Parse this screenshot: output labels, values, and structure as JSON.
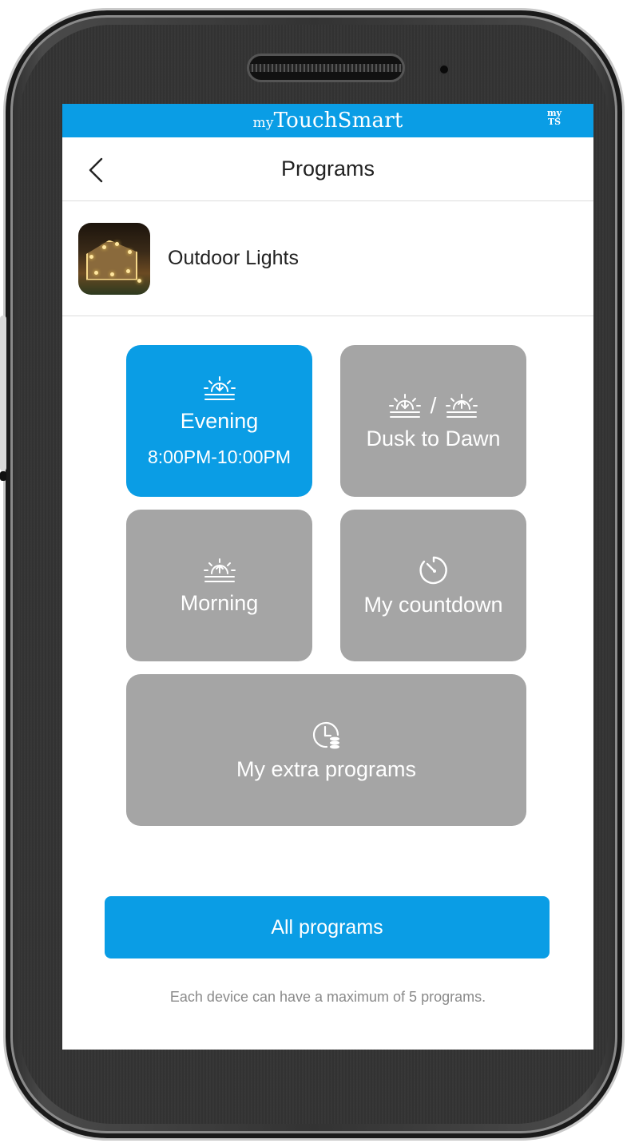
{
  "app": {
    "brand_prefix": "my",
    "brand_name": "TouchSmart",
    "brand_logo_line1": "my",
    "brand_logo_line2": "TS"
  },
  "nav": {
    "title": "Programs",
    "back_icon": "chevron-left-icon"
  },
  "device": {
    "name": "Outdoor Lights"
  },
  "programs": [
    {
      "label": "Evening",
      "time": "8:00PM-10:00PM",
      "icon": "sunset-icon",
      "active": true
    },
    {
      "label": "Dusk to Dawn",
      "separator": "/",
      "icon": "sunset-sunrise-icon",
      "active": false
    },
    {
      "label": "Morning",
      "icon": "sunrise-icon",
      "active": false
    },
    {
      "label": "My countdown",
      "icon": "timer-icon",
      "active": false
    },
    {
      "label": "My extra programs",
      "icon": "clock-stack-icon",
      "active": false
    }
  ],
  "actions": {
    "all_programs": "All programs"
  },
  "footnote": "Each device can have a maximum of 5 programs.",
  "colors": {
    "accent": "#0a9de5",
    "tile_inactive": "#a5a5a5"
  }
}
